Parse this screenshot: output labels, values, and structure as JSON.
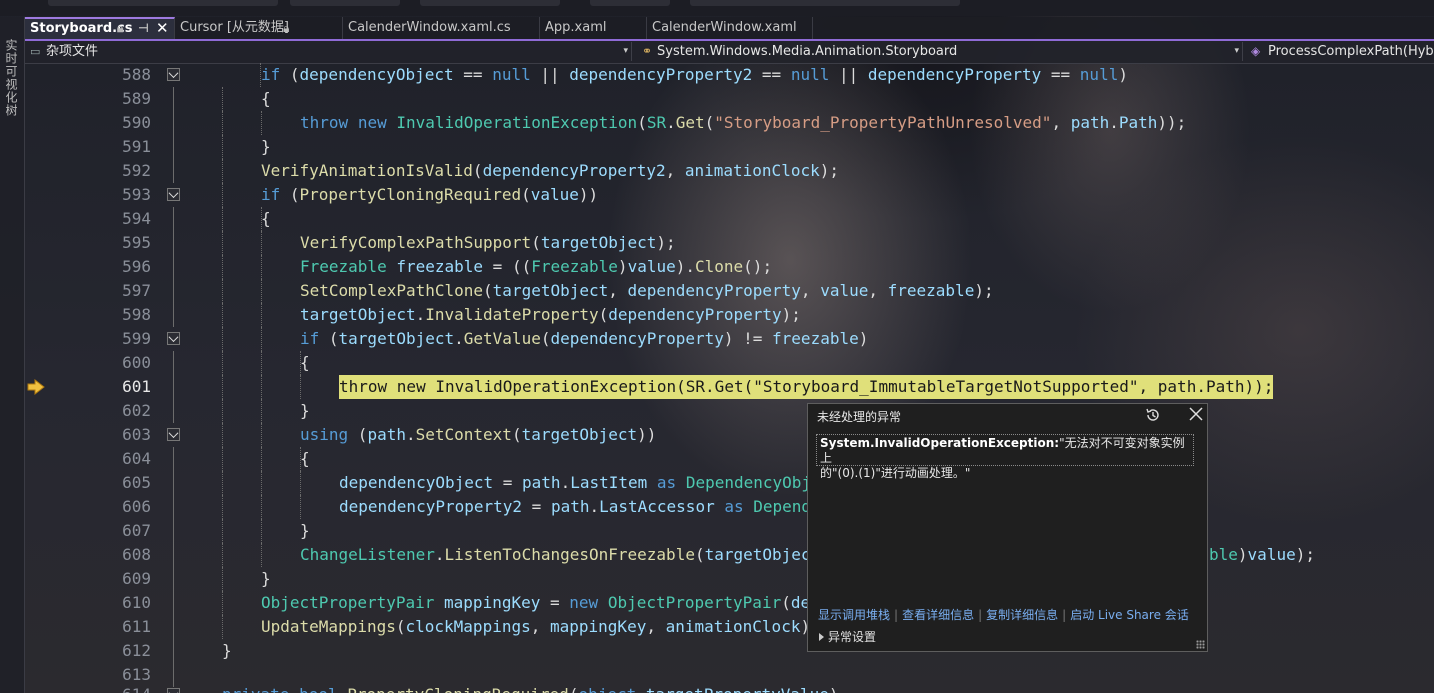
{
  "tabs": [
    {
      "label": "Storyboard.cs",
      "active": true,
      "pinned": true,
      "closable": true
    },
    {
      "label": "Cursor [从元数据]",
      "active": false,
      "pinned": true
    },
    {
      "label": "CalenderWindow.xaml.cs",
      "active": false
    },
    {
      "label": "App.xaml",
      "active": false
    },
    {
      "label": "CalenderWindow.xaml",
      "active": false
    }
  ],
  "nav": {
    "project": "杂项文件",
    "type": "System.Windows.Media.Animation.Storyboard",
    "member": "ProcessComplexPath(Hybrid"
  },
  "sidebar": {
    "label": "实时可视化树"
  },
  "current_line": 601,
  "code_lines": [
    {
      "n": 588,
      "fold": true
    },
    {
      "n": 589
    },
    {
      "n": 590
    },
    {
      "n": 591
    },
    {
      "n": 592
    },
    {
      "n": 593,
      "fold": true
    },
    {
      "n": 594
    },
    {
      "n": 595
    },
    {
      "n": 596
    },
    {
      "n": 597
    },
    {
      "n": 598
    },
    {
      "n": 599,
      "fold": true
    },
    {
      "n": 600
    },
    {
      "n": 601
    },
    {
      "n": 602
    },
    {
      "n": 603,
      "fold": true
    },
    {
      "n": 604
    },
    {
      "n": 605
    },
    {
      "n": 606
    },
    {
      "n": 607
    },
    {
      "n": 608
    },
    {
      "n": 609
    },
    {
      "n": 610
    },
    {
      "n": 611
    },
    {
      "n": 612
    },
    {
      "n": 613
    },
    {
      "n": 614,
      "fold": true
    }
  ],
  "code_text": {
    "l588": [
      "if",
      " (",
      "dependencyObject",
      " == ",
      "null",
      " || ",
      "dependencyProperty2",
      " == ",
      "null",
      " || ",
      "dependencyProperty",
      " == ",
      "null",
      ")"
    ],
    "l589": [
      "{"
    ],
    "l590": [
      "throw",
      " ",
      "new",
      " ",
      "InvalidOperationException",
      "(",
      "SR",
      ".",
      "Get",
      "(",
      "\"Storyboard_PropertyPathUnresolved\"",
      ", ",
      "path",
      ".",
      "Path",
      "));"
    ],
    "l591": [
      "}"
    ],
    "l592": [
      "VerifyAnimationIsValid",
      "(",
      "dependencyProperty2",
      ", ",
      "animationClock",
      ");"
    ],
    "l593": [
      "if",
      " (",
      "PropertyCloningRequired",
      "(",
      "value",
      "))"
    ],
    "l594": [
      "{"
    ],
    "l595": [
      "VerifyComplexPathSupport",
      "(",
      "targetObject",
      ");"
    ],
    "l596": [
      "Freezable",
      " ",
      "freezable",
      " = ((",
      "Freezable",
      ")",
      "value",
      ").",
      "Clone",
      "();"
    ],
    "l597": [
      "SetComplexPathClone",
      "(",
      "targetObject",
      ", ",
      "dependencyProperty",
      ", ",
      "value",
      ", ",
      "freezable",
      ");"
    ],
    "l598": [
      "targetObject",
      ".",
      "InvalidateProperty",
      "(",
      "dependencyProperty",
      ");"
    ],
    "l599": [
      "if",
      " (",
      "targetObject",
      ".",
      "GetValue",
      "(",
      "dependencyProperty",
      ") != ",
      "freezable",
      ")"
    ],
    "l600": [
      "{"
    ],
    "l601": [
      "throw new InvalidOperationException(SR.Get(\"Storyboard_ImmutableTargetNotSupported\", path.Path));"
    ],
    "l602": [
      "}"
    ],
    "l603": [
      "using",
      " (",
      "path",
      ".",
      "SetContext",
      "(",
      "targetObject",
      "))"
    ],
    "l604": [
      "{"
    ],
    "l605": [
      "dependencyObject",
      " = ",
      "path",
      ".",
      "LastItem",
      " ",
      "as",
      " ",
      "DependencyObj"
    ],
    "l606": [
      "dependencyProperty2",
      " = ",
      "path",
      ".",
      "LastAccessor",
      " ",
      "as",
      " ",
      "Depend"
    ],
    "l607": [
      "}"
    ],
    "l608a": [
      "ChangeListener",
      ".",
      "ListenToChangesOnFreezable",
      "(",
      "targetObjec"
    ],
    "l608b": [
      "ble",
      ")",
      "value",
      ");"
    ],
    "l609": [
      "}"
    ],
    "l610": [
      "ObjectPropertyPair",
      " ",
      "mappingKey",
      " = ",
      "new",
      " ",
      "ObjectPropertyPair",
      "(",
      "de"
    ],
    "l611": [
      "UpdateMappings",
      "(",
      "clockMappings",
      ", ",
      "mappingKey",
      ", ",
      "animationClock",
      ")"
    ],
    "l612": [
      "}"
    ],
    "l613": [
      ""
    ],
    "l614": [
      "private",
      " ",
      "bool",
      " ",
      "PropertyCloningRequired",
      "(",
      "object",
      " ",
      "targetPropertyValue",
      ")"
    ]
  },
  "exception_popup": {
    "title": "未经处理的异常",
    "exception_type": "System.InvalidOperationException:",
    "message_line1": "\"无法对不可变对象实例上",
    "message_line2": "的\"(0).(1)\"进行动画处理。\"",
    "links": [
      "显示调用堆栈",
      "查看详细信息",
      "复制详细信息",
      "启动 Live Share 会话"
    ],
    "settings_label": "异常设置"
  },
  "colors": {
    "accent": "#8f6bd6",
    "keyword": "#569cd6",
    "type": "#4ec9b0",
    "method": "#dcdcaa",
    "variable": "#9cdcfe",
    "string": "#d69d85",
    "highlight": "#e0e07a",
    "link": "#79aef0"
  }
}
